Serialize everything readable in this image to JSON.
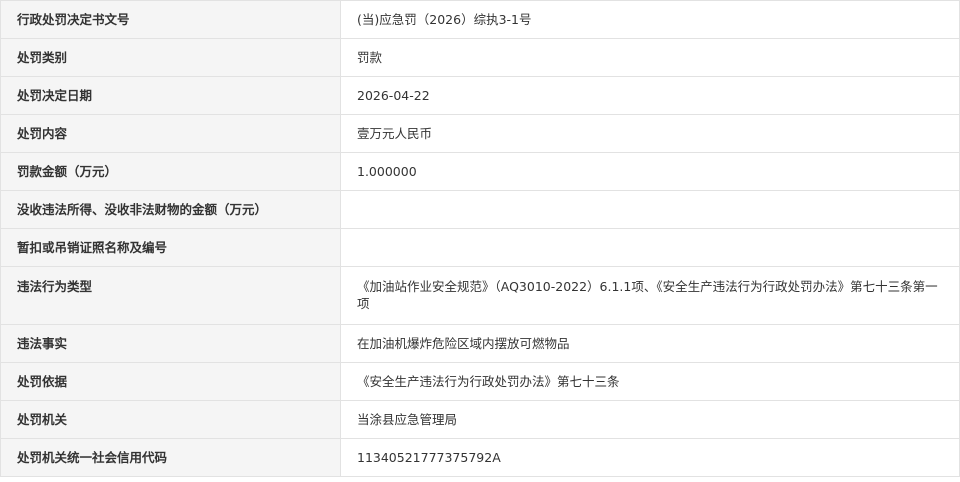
{
  "rows": [
    {
      "label": "行政处罚决定书文号",
      "value": "(当)应急罚（2026）综执3-1号"
    },
    {
      "label": "处罚类别",
      "value": "罚款"
    },
    {
      "label": "处罚决定日期",
      "value": "2026-04-22"
    },
    {
      "label": "处罚内容",
      "value": "壹万元人民币"
    },
    {
      "label": "罚款金额（万元）",
      "value": "1.000000"
    },
    {
      "label": "没收违法所得、没收非法财物的金额（万元）",
      "value": ""
    },
    {
      "label": "暂扣或吊销证照名称及编号",
      "value": ""
    },
    {
      "label": "违法行为类型",
      "value": "《加油站作业安全规范》（AQ3010-2022）6.1.1项、《安全生产违法行为行政处罚办法》第七十三条第一项"
    },
    {
      "label": "违法事实",
      "value": "在加油机爆炸危险区域内摆放可燃物品"
    },
    {
      "label": "处罚依据",
      "value": "《安全生产违法行为行政处罚办法》第七十三条"
    },
    {
      "label": "处罚机关",
      "value": "当涂县应急管理局"
    },
    {
      "label": "处罚机关统一社会信用代码",
      "value": "11340521777375792A"
    }
  ]
}
